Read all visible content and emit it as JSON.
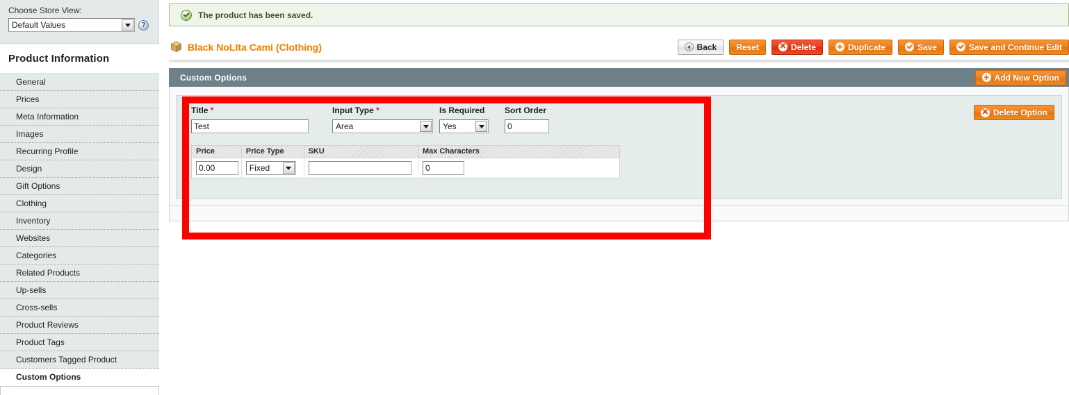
{
  "sidebar": {
    "store_view_label": "Choose Store View:",
    "store_view_value": "Default Values",
    "help_icon_glyph": "?",
    "section_title": "Product Information",
    "items": [
      {
        "label": "General",
        "active": false
      },
      {
        "label": "Prices",
        "active": false
      },
      {
        "label": "Meta Information",
        "active": false
      },
      {
        "label": "Images",
        "active": false
      },
      {
        "label": "Recurring Profile",
        "active": false
      },
      {
        "label": "Design",
        "active": false
      },
      {
        "label": "Gift Options",
        "active": false
      },
      {
        "label": "Clothing",
        "active": false
      },
      {
        "label": "Inventory",
        "active": false
      },
      {
        "label": "Websites",
        "active": false
      },
      {
        "label": "Categories",
        "active": false
      },
      {
        "label": "Related Products",
        "active": false
      },
      {
        "label": "Up-sells",
        "active": false
      },
      {
        "label": "Cross-sells",
        "active": false
      },
      {
        "label": "Product Reviews",
        "active": false
      },
      {
        "label": "Product Tags",
        "active": false
      },
      {
        "label": "Customers Tagged Product",
        "active": false
      },
      {
        "label": "Custom Options",
        "active": true
      }
    ]
  },
  "message": {
    "text": "The product has been saved.",
    "icon": "success-check-icon",
    "background": "#eff5ea",
    "border": "#a2b88c"
  },
  "header": {
    "title": "Black NoLIta Cami (Clothing)",
    "title_color": "#f07d00",
    "icon": "product-box-icon",
    "buttons": [
      {
        "label": "Back",
        "icon": "arrow-left-icon",
        "style": "gray"
      },
      {
        "label": "Reset",
        "icon": "",
        "style": "orange"
      },
      {
        "label": "Delete",
        "icon": "delete-circle-icon",
        "style": "red"
      },
      {
        "label": "Duplicate",
        "icon": "plus-circle-icon",
        "style": "orange"
      },
      {
        "label": "Save",
        "icon": "check-circle-icon",
        "style": "orange"
      },
      {
        "label": "Save and Continue Edit",
        "icon": "check-circle-icon",
        "style": "orange"
      }
    ]
  },
  "custom_options": {
    "panel_title": "Custom Options",
    "panel_header_color": "#6e8189",
    "add_new_option_label": "Add New Option",
    "delete_option_label": "Delete Option",
    "option": {
      "fields": {
        "title": {
          "label": "Title",
          "required": true,
          "value": "Test"
        },
        "input_type": {
          "label": "Input Type",
          "required": true,
          "value": "Area"
        },
        "is_required": {
          "label": "Is Required",
          "required": false,
          "value": "Yes"
        },
        "sort_order": {
          "label": "Sort Order",
          "required": false,
          "value": "0"
        }
      },
      "price_table": {
        "columns": [
          "Price",
          "Price Type",
          "SKU",
          "Max Characters"
        ],
        "rows": [
          {
            "price": "0.00",
            "price_type": "Fixed",
            "sku": "",
            "max_characters": "0"
          }
        ]
      }
    }
  },
  "annotation": {
    "shape": "rectangle",
    "color": "#ff0000",
    "stroke_width": 10
  }
}
